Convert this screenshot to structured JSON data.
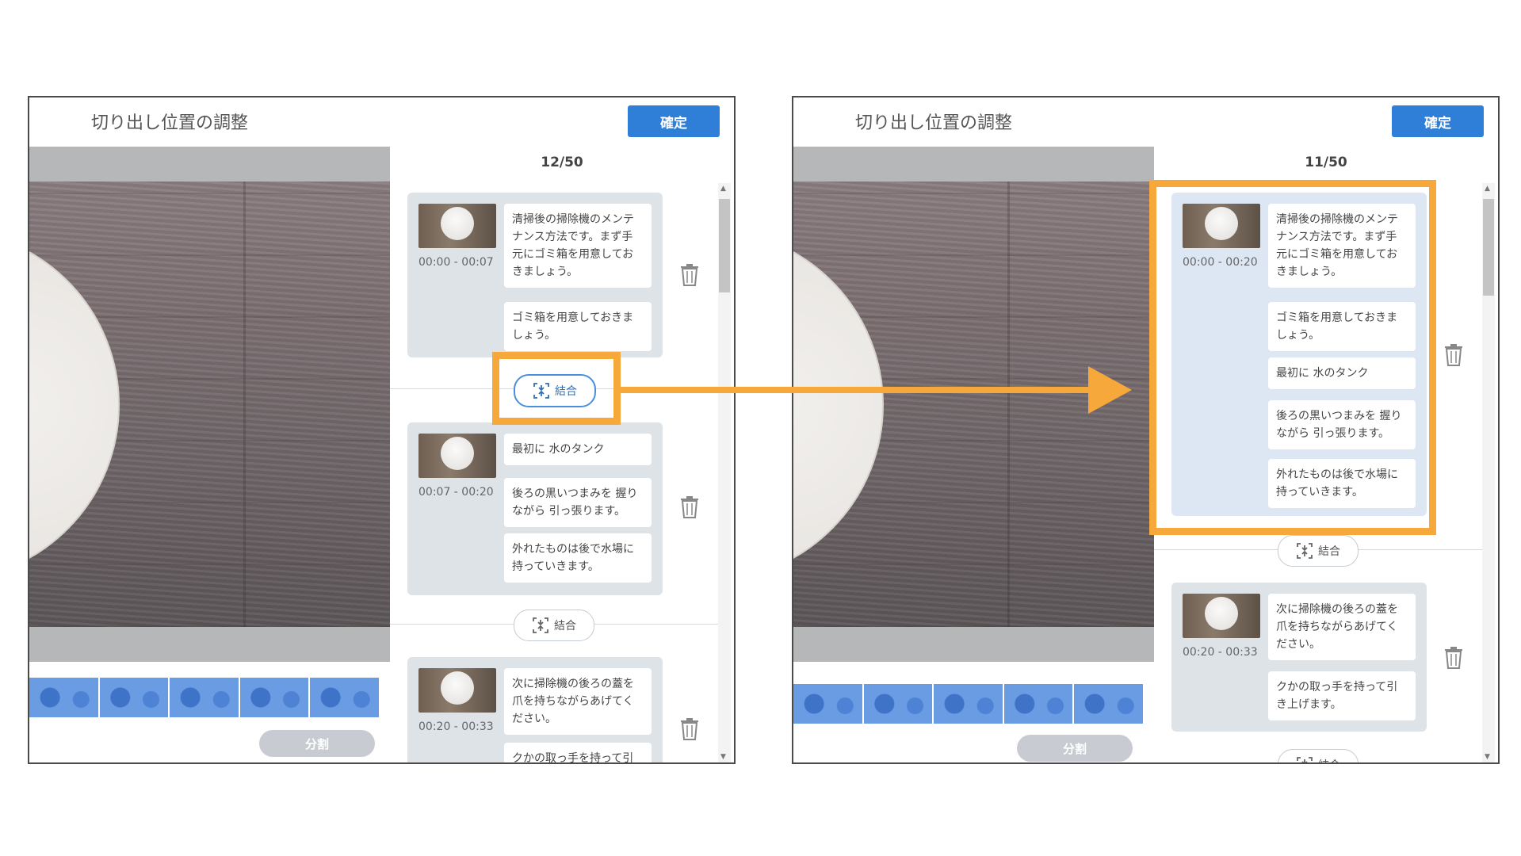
{
  "left_panel": {
    "title": "切り出し位置の調整",
    "confirm_label": "確定",
    "split_label": "分割",
    "counter": "12/50",
    "cards": [
      {
        "time": "00:00 - 00:07",
        "texts": [
          "清掃後の掃除機のメンテナンス方法です。まず手元にゴミ箱を用意しておきましょう。",
          "ゴミ箱を用意しておきましょう。"
        ]
      },
      {
        "time": "00:07 - 00:20",
        "texts": [
          "最初に 水のタンク",
          "後ろの黒いつまみを 握りながら 引っ張ります。",
          "外れたものは後で水場に持っていきます。"
        ]
      },
      {
        "time": "00:20 - 00:33",
        "texts": [
          "次に掃除機の後ろの蓋を爪を持ちながらあげてください。",
          "クかの取っ手を持って引"
        ]
      }
    ],
    "merge_labels": [
      "結合",
      "結合"
    ]
  },
  "right_panel": {
    "title": "切り出し位置の調整",
    "confirm_label": "確定",
    "split_label": "分割",
    "counter": "11/50",
    "cards": [
      {
        "time": "00:00 - 00:20",
        "texts": [
          "清掃後の掃除機のメンテナンス方法です。まず手元にゴミ箱を用意しておきましょう。",
          "ゴミ箱を用意しておきましょう。",
          "最初に 水のタンク",
          "後ろの黒いつまみを 握りながら 引っ張ります。",
          "外れたものは後で水場に持っていきます。"
        ]
      },
      {
        "time": "00:20 - 00:33",
        "texts": [
          "次に掃除機の後ろの蓋を爪を持ちながらあげてください。",
          "クかの取っ手を持って引き上げます。"
        ]
      }
    ],
    "merge_labels": [
      "結合",
      "結合"
    ]
  },
  "colors": {
    "accent_blue": "#2f7fd8",
    "highlight_orange": "#f7a83b",
    "card_bg": "#dee3e8"
  }
}
